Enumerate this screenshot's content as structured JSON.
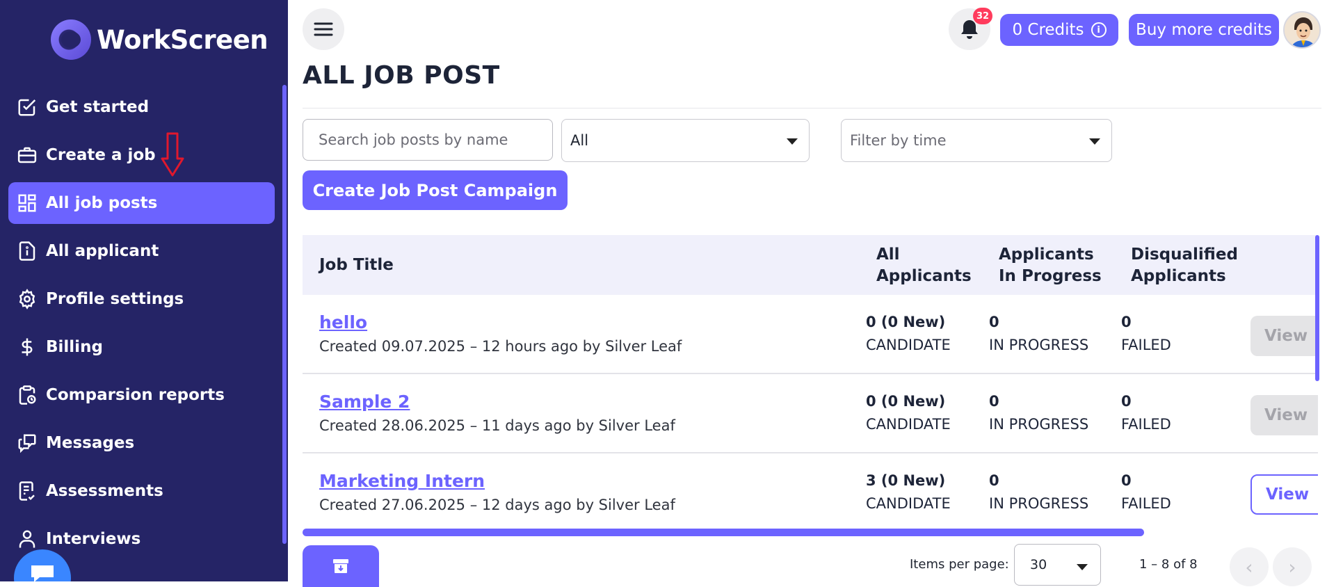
{
  "app": {
    "logo_text": "WorkScreen",
    "accent_color": "#6c63ff",
    "sidebar_color": "#252466"
  },
  "sidebar": {
    "items": [
      {
        "label": "Get started",
        "icon": "checkbox-icon"
      },
      {
        "label": "Create a job",
        "icon": "briefcase-icon"
      },
      {
        "label": "All job posts",
        "icon": "dashboard-icon",
        "active": true
      },
      {
        "label": "All applicant",
        "icon": "document-info-icon"
      },
      {
        "label": "Profile settings",
        "icon": "gear-icon"
      },
      {
        "label": "Billing",
        "icon": "dollar-icon"
      },
      {
        "label": "Comparsion reports",
        "icon": "clipboard-clock-icon"
      },
      {
        "label": "Messages",
        "icon": "chat-icon"
      },
      {
        "label": "Assessments",
        "icon": "checklist-icon"
      },
      {
        "label": "Interviews",
        "icon": "person-icon"
      }
    ]
  },
  "header": {
    "notification_count": "32",
    "credits_label": "0 Credits",
    "buy_credits_label": "Buy more credits"
  },
  "page": {
    "title": "ALL JOB POST"
  },
  "filters": {
    "search_placeholder": "Search job posts by name",
    "status_value": "All",
    "time_placeholder": "Filter by time"
  },
  "actions": {
    "create_campaign_label": "Create Job Post Campaign"
  },
  "table": {
    "headers": {
      "job_title": "Job Title",
      "all_applicants_1": "All",
      "all_applicants_2": "Applicants",
      "in_progress_1": "Applicants",
      "in_progress_2": "In Progress",
      "disqualified_1": "Disqualified",
      "disqualified_2": "Applicants"
    },
    "rows": [
      {
        "title": "hello",
        "meta": "Created 09.07.2025 – 12 hours ago by Silver Leaf",
        "all_count": "0 (0 New)",
        "all_label": "CANDIDATE",
        "progress_count": "0",
        "progress_label": "IN PROGRESS",
        "failed_count": "0",
        "failed_label": "FAILED",
        "view_label": "View"
      },
      {
        "title": "Sample 2",
        "meta": "Created 28.06.2025 – 11 days ago by Silver Leaf",
        "all_count": "0 (0 New)",
        "all_label": "CANDIDATE",
        "progress_count": "0",
        "progress_label": "IN PROGRESS",
        "failed_count": "0",
        "failed_label": "FAILED",
        "view_label": "View"
      },
      {
        "title": "Marketing Intern",
        "meta": "Created 27.06.2025 – 12 days ago by Silver Leaf",
        "all_count": "3 (0 New)",
        "all_label": "CANDIDATE",
        "progress_count": "0",
        "progress_label": "IN PROGRESS",
        "failed_count": "0",
        "failed_label": "FAILED",
        "view_label": "View"
      }
    ]
  },
  "pagination": {
    "items_per_page_label": "Items per page:",
    "items_per_page_value": "30",
    "range_label": "1 – 8 of 8"
  }
}
